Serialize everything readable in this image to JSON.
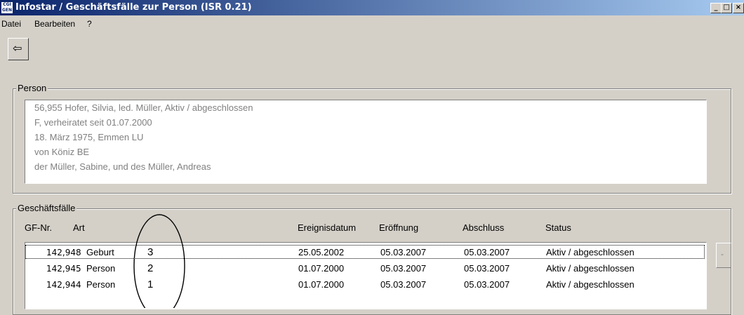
{
  "window": {
    "title": "Infostar / Geschäftsfälle zur Person (ISR 0.21)",
    "icon_text": "CGI GEN",
    "minimize": "_",
    "maximize": "□",
    "close": "×"
  },
  "menu": {
    "items": [
      {
        "label": "Datei"
      },
      {
        "label": "Bearbeiten"
      },
      {
        "label": "?"
      }
    ]
  },
  "toolbar": {
    "exit_icon": "exit-door-icon",
    "exit_glyph": "⇦"
  },
  "person": {
    "legend": "Person",
    "lines": [
      "56,955  Hofer, Silvia, led. Müller, Aktiv / abgeschlossen",
      "F, verheiratet seit 01.07.2000",
      "18. März 1975, Emmen LU",
      "von Köniz BE",
      "der Müller, Sabine, und des Müller, Andreas"
    ]
  },
  "cases": {
    "legend": "Geschäftsfälle",
    "columns": [
      "GF-Nr.",
      "Art",
      "Ereignisdatum",
      "Eröffnung",
      "Abschluss",
      "Status"
    ],
    "rows": [
      {
        "nr": "142,948",
        "art": "Geburt",
        "num": "3",
        "ereignis": "25.05.2002",
        "eroeffnung": "05.03.2007",
        "abschluss": "05.03.2007",
        "status": "Aktiv / abgeschlossen",
        "selected": true
      },
      {
        "nr": "142,945",
        "art": "Person",
        "num": "2",
        "ereignis": "01.07.2000",
        "eroeffnung": "05.03.2007",
        "abschluss": "05.03.2007",
        "status": "Aktiv / abgeschlossen",
        "selected": false
      },
      {
        "nr": "142,944",
        "art": "Person",
        "num": "1",
        "ereignis": "01.07.2000",
        "eroeffnung": "05.03.2007",
        "abschluss": "05.03.2007",
        "status": "Aktiv / abgeschlossen",
        "selected": false
      }
    ],
    "side_button": "-"
  }
}
